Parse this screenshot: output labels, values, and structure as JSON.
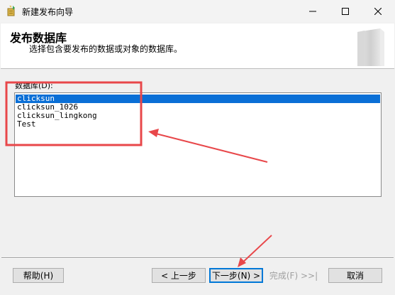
{
  "window": {
    "title": "新建发布向导",
    "icon": "wizard-app-icon"
  },
  "titlebar_controls": {
    "minimize_icon": "minimize-icon",
    "maximize_icon": "maximize-icon",
    "close_icon": "close-icon"
  },
  "header": {
    "title": "发布数据库",
    "subtitle": "选择包含要发布的数据或对象的数据库。",
    "graphic": "database-cylinder-graphic"
  },
  "list": {
    "label": "数据库(D):",
    "items": [
      "clicksun",
      "clicksun_1026",
      "clicksun_lingkong",
      "Test"
    ],
    "selected_index": 0
  },
  "buttons": {
    "help": "帮助(H)",
    "prev": "< 上一步",
    "next": "下一步(N) >",
    "finish": "完成(F) >>|",
    "cancel": "取消"
  },
  "colors": {
    "selection": "#0a6fd6",
    "annotation": "#e8474a",
    "background": "#f0f0f0"
  }
}
